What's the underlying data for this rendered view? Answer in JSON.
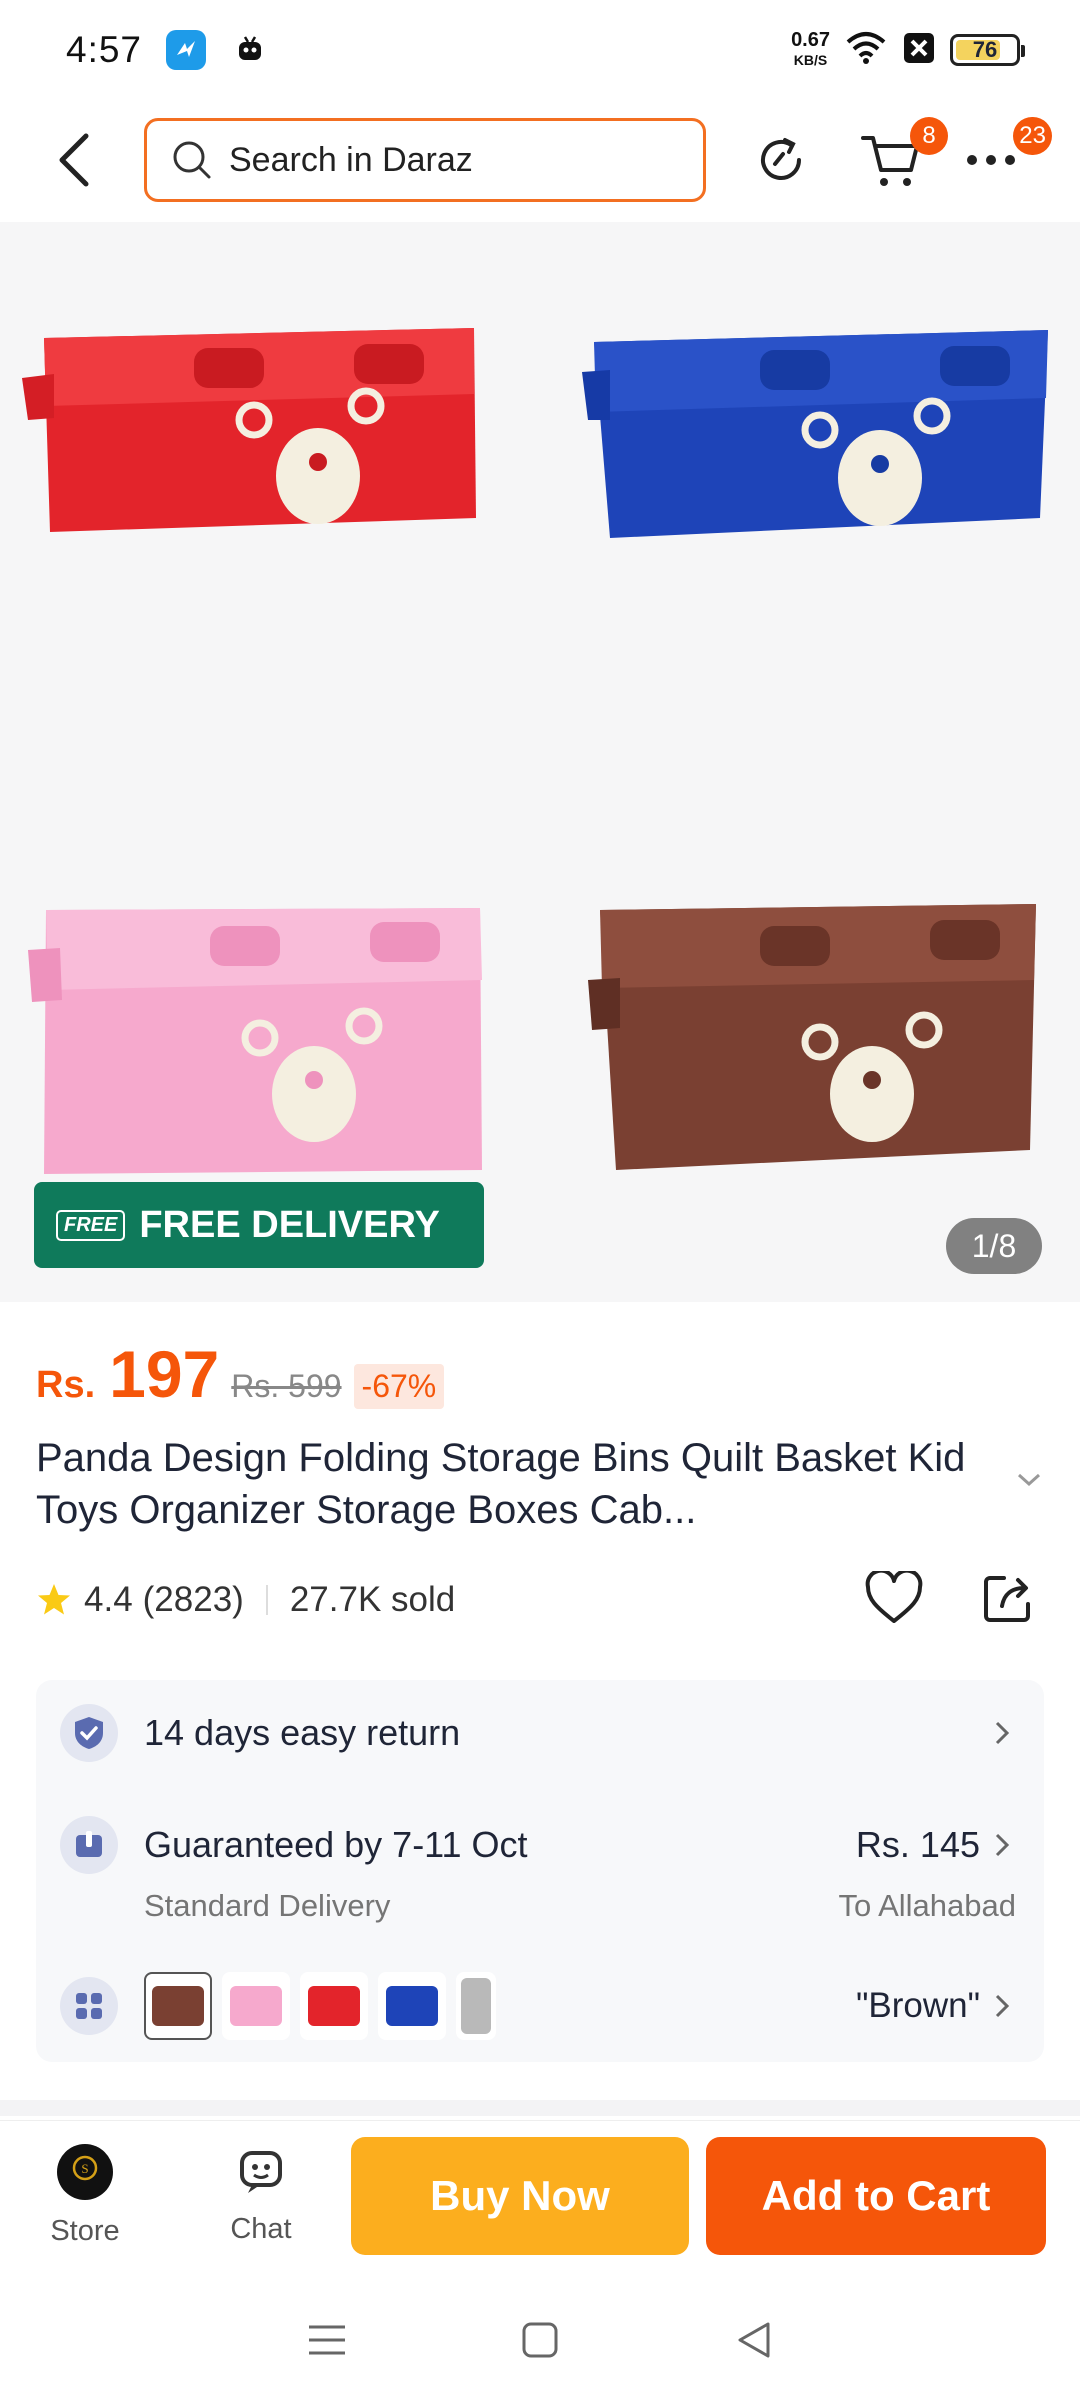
{
  "status_bar": {
    "time": "4:57",
    "net_speed": "0.67",
    "net_unit": "KB/S",
    "battery": "76",
    "battery_level": 0.76
  },
  "header": {
    "search_placeholder": "Search in Daraz",
    "cart_count": "8",
    "more_count": "23"
  },
  "gallery": {
    "free_delivery_label": "FREE DELIVERY",
    "free_badge": "FREE",
    "counter": "1/8",
    "box_colors": [
      "#e3242b",
      "#1e44b8",
      "#f6a9cd",
      "#7a4032"
    ]
  },
  "product": {
    "currency": "Rs.",
    "price": "197",
    "old_price": "Rs. 599",
    "discount": "-67%",
    "title": "Panda Design Folding Storage Bins Quilt Basket Kid Toys Organizer Storage Boxes Cab...",
    "rating": "4.4",
    "reviews": "(2823)",
    "sold": "27.7K sold"
  },
  "info": {
    "return_text": "14 days easy return",
    "delivery_text": "Guaranteed by 7-11 Oct",
    "delivery_type": "Standard Delivery",
    "delivery_price": "Rs. 145",
    "delivery_location": "To Allahabad",
    "variant_selected": "\"Brown\"",
    "swatch_colors": [
      "#7a4032",
      "#f6a9cd",
      "#e3242b",
      "#1e44b8",
      "#b9b9b9"
    ]
  },
  "bottom_bar": {
    "store_label": "Store",
    "chat_label": "Chat",
    "buy_now_label": "Buy Now",
    "add_to_cart_label": "Add to Cart"
  },
  "colors": {
    "accent": "#f5560a",
    "buy_now": "#fcae1e",
    "free_delivery": "#0f7a5b"
  }
}
